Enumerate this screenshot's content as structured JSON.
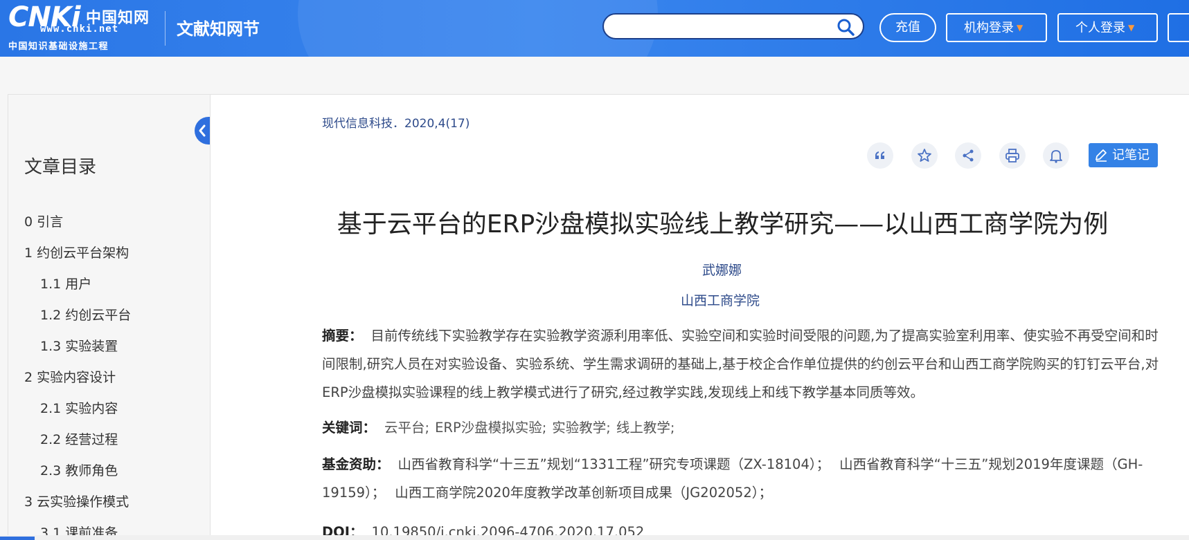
{
  "header": {
    "logo_cnki": "CNKi",
    "logo_zh": "中国知网",
    "logo_url": "www.cnki.net",
    "logo_sub": "中国知识基础设施工程",
    "site_name": "文献知网节",
    "search_placeholder": "",
    "recharge_label": "充值",
    "institution_login_label": "机构登录",
    "personal_login_label": "个人登录",
    "brand_color": "#2a76e6",
    "accent_color": "#ff9a3c"
  },
  "sidebar": {
    "title": "文章目录",
    "items": [
      {
        "label": "0 引言",
        "level": 1
      },
      {
        "label": "1 约创云平台架构",
        "level": 1
      },
      {
        "label": "1.1 用户",
        "level": 2
      },
      {
        "label": "1.2 约创云平台",
        "level": 2
      },
      {
        "label": "1.3 实验装置",
        "level": 2
      },
      {
        "label": "2 实验内容设计",
        "level": 1
      },
      {
        "label": "2.1 实验内容",
        "level": 2
      },
      {
        "label": "2.2 经营过程",
        "level": 2
      },
      {
        "label": "2.3 教师角色",
        "level": 2
      },
      {
        "label": "3 云实验操作模式",
        "level": 1
      },
      {
        "label": "3.1 课前准备",
        "level": 2
      }
    ]
  },
  "article": {
    "source": "现代信息科技．2020,4(17)",
    "toolbar": {
      "icons": [
        "quote-icon",
        "star-icon",
        "share-icon",
        "print-icon",
        "bell-icon"
      ],
      "note_label": "记笔记"
    },
    "title": "基于云平台的ERP沙盘模拟实验线上教学研究——以山西工商学院为例",
    "author": "武娜娜",
    "institution": "山西工商学院",
    "abstract_label": "摘要：",
    "abstract": "目前传统线下实验教学存在实验教学资源利用率低、实验空间和实验时间受限的问题,为了提高实验室利用率、使实验不再受空间和时间限制,研究人员在对实验设备、实验系统、学生需求调研的基础上,基于校企合作单位提供的约创云平台和山西工商学院购买的钉钉云平台,对ERP沙盘模拟实验课程的线上教学模式进行了研究,经过教学实践,发现线上和线下教学基本同质等效。",
    "keywords_label": "关键词：",
    "keywords": [
      "云平台;",
      "ERP沙盘模拟实验;",
      "实验教学;",
      "线上教学;"
    ],
    "funds_label": "基金资助：",
    "funds": [
      "山西省教育科学“十三五”规划“1331工程”研究专项课题（ZX-18104）；",
      "山西省教育科学“十三五”规划2019年度课题（GH-19159）；",
      "山西工商学院2020年度教学改革创新项目成果（JG202052）；"
    ],
    "doi_label": "DOI：",
    "doi": "10.19850/j.cnki.2096-4706.2020.17.052"
  }
}
